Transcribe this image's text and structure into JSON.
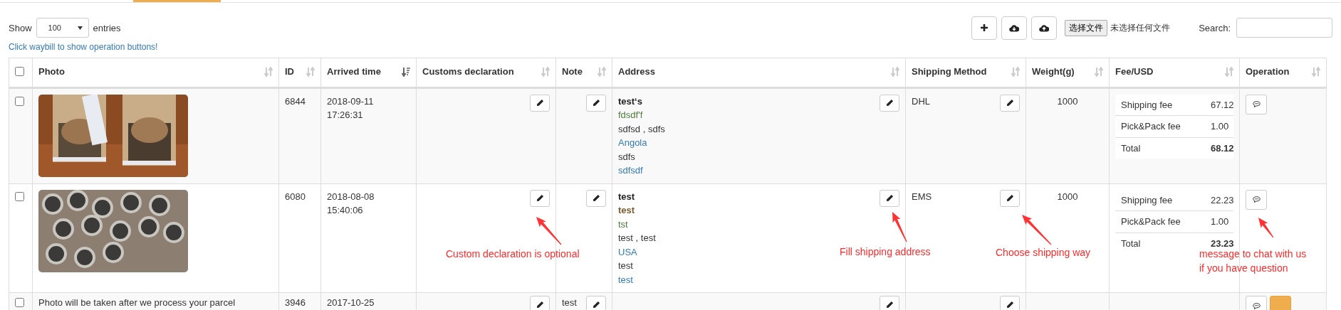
{
  "toolbar": {
    "show_label": "Show",
    "page_size": "100",
    "entries_label": "entries",
    "hint": "Click waybill to show operation buttons!",
    "icon_buttons": [
      {
        "kind": "add"
      },
      {
        "kind": "download"
      },
      {
        "kind": "upload"
      }
    ],
    "file_button": "选择文件",
    "file_status": "未选择任何文件",
    "search_label": "Search:"
  },
  "table": {
    "select_all": {
      "checked": false
    },
    "columns": [
      {
        "label": "Photo",
        "kind": "both"
      },
      {
        "label": "ID",
        "kind": "both"
      },
      {
        "label": "Arrived time",
        "kind": "desc"
      },
      {
        "label": "Customs declaration",
        "kind": "both"
      },
      {
        "label": "Note",
        "kind": "both"
      },
      {
        "label": "Address",
        "kind": "both"
      },
      {
        "label": "Shipping Method",
        "kind": "both"
      },
      {
        "label": "Weight(g)",
        "kind": "both"
      },
      {
        "label": "Fee/USD",
        "kind": "both"
      },
      {
        "label": "Operation",
        "kind": "both"
      }
    ],
    "rows": [
      {
        "checked": false,
        "photo": {
          "kind": "picture"
        },
        "id": "6844",
        "arrived": [
          "2018-09-11",
          "17:26:31"
        ],
        "address": [
          {
            "text": "test‘s",
            "kind": "bold"
          },
          {
            "text": "fdsdf'f",
            "kind": "green"
          },
          {
            "text": "sdfsd , sdfs",
            "kind": "plain"
          },
          {
            "text": "Angola",
            "kind": "link"
          },
          {
            "text": "sdfs",
            "kind": "plain"
          },
          {
            "text": "sdfsdf",
            "kind": "link"
          }
        ],
        "shipping": "DHL",
        "weight": "1000",
        "fees": [
          {
            "label": "Shipping fee",
            "amount": "67.12",
            "kind": "item"
          },
          {
            "label": "Pick&Pack fee",
            "amount": "1.00",
            "kind": "item"
          },
          {
            "label": "Total",
            "amount": "68.12",
            "kind": "total"
          }
        ],
        "operations": [
          {
            "kind": "chat"
          }
        ],
        "annotations": []
      },
      {
        "checked": false,
        "photo": {
          "kind": "picture"
        },
        "id": "6080",
        "arrived": [
          "2018-08-08",
          "15:40:06"
        ],
        "address": [
          {
            "text": "test",
            "kind": "bold"
          },
          {
            "text": "test",
            "kind": "brown"
          },
          {
            "text": "tst",
            "kind": "green"
          },
          {
            "text": "test , test",
            "kind": "plain"
          },
          {
            "text": "USA",
            "kind": "link"
          },
          {
            "text": "test",
            "kind": "plain"
          },
          {
            "text": "test",
            "kind": "link"
          }
        ],
        "shipping": "EMS",
        "weight": "1000",
        "fees": [
          {
            "label": "Shipping fee",
            "amount": "22.23",
            "kind": "item"
          },
          {
            "label": "Pick&Pack fee",
            "amount": "1.00",
            "kind": "item"
          },
          {
            "label": "Total",
            "amount": "23.23",
            "kind": "total"
          }
        ],
        "operations": [
          {
            "kind": "chat"
          }
        ],
        "annotations": [
          {
            "kind": "customs",
            "lines": [
              "Custom declaration is optional"
            ]
          },
          {
            "kind": "address",
            "lines": [
              "Fill shipping address"
            ]
          },
          {
            "kind": "shipping",
            "lines": [
              "Choose shipping way"
            ]
          },
          {
            "kind": "operation",
            "lines": [
              "message to chat with us",
              "if you have question"
            ]
          }
        ]
      },
      {
        "checked": false,
        "photo": {
          "kind": "note",
          "text": "Photo will be taken after we process your parcel"
        },
        "id": "3946",
        "arrived": [
          "2017-10-25"
        ],
        "note": "test",
        "address": [],
        "shipping": "",
        "weight": "",
        "fees": [],
        "operations": [
          {
            "kind": "chat"
          },
          {
            "kind": "action"
          }
        ],
        "annotations": []
      }
    ]
  }
}
